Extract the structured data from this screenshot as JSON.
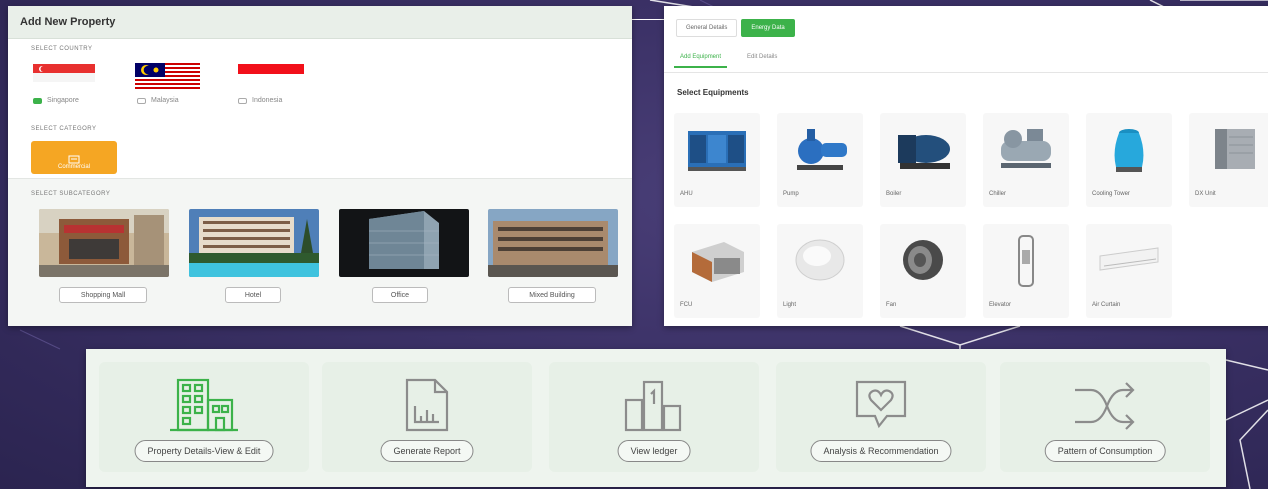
{
  "colors": {
    "accent": "#3cb24a",
    "category": "#f5a623",
    "background": "#3b3166"
  },
  "add_property": {
    "title": "Add New Property",
    "country_label": "SELECT COUNTRY",
    "countries": [
      {
        "label": "Singapore",
        "selected": true
      },
      {
        "label": "Malaysia",
        "selected": false
      },
      {
        "label": "Indonesia",
        "selected": false
      }
    ],
    "category_label": "SELECT CATEGORY",
    "category_button": "Commercial",
    "subcategory_label": "SELECT SUBCATEGORY",
    "subcategories": [
      "Shopping Mall",
      "Hotel",
      "Office",
      "Mixed Building"
    ]
  },
  "equipment": {
    "tabs": [
      "General Details",
      "Energy Data"
    ],
    "subtabs": [
      "Add Equipment",
      "Edit Details"
    ],
    "select_title": "Select Equipments",
    "items": [
      "AHU",
      "Pump",
      "Boiler",
      "Chiller",
      "Cooling Tower",
      "DX Unit",
      "FCU",
      "Light",
      "Fan",
      "Elevator",
      "Air Curtain"
    ]
  },
  "actions": [
    {
      "label": "Property Details-View & Edit",
      "icon": "building-icon"
    },
    {
      "label": "Generate Report",
      "icon": "report-chart-icon"
    },
    {
      "label": "View ledger",
      "icon": "ledger-bars-icon"
    },
    {
      "label": "Analysis & Recommendation",
      "icon": "heart-chat-icon"
    },
    {
      "label": "Pattern of Consumption",
      "icon": "shuffle-arrows-icon"
    }
  ]
}
